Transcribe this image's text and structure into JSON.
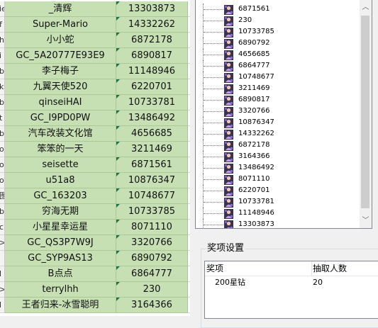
{
  "sheet": {
    "row_header_glyphs": [
      "ie",
      "f",
      "h",
      "i",
      "b",
      "k",
      "b",
      "t",
      "b",
      "o",
      "o",
      "o",
      "图",
      "b",
      "c",
      ">",
      "",
      "l",
      ">",
      "l"
    ],
    "rows": [
      {
        "name": "_清辉",
        "id": "13303873"
      },
      {
        "name": "Super-Mario",
        "id": "14332262"
      },
      {
        "name": "小小蛇",
        "id": "6872178"
      },
      {
        "name": "GC_5A20777E93E9",
        "id": "6890817"
      },
      {
        "name": "李子梅子",
        "id": "11148946"
      },
      {
        "name": "九翼天使520",
        "id": "6220701"
      },
      {
        "name": "qinseiHAI",
        "id": "10733781"
      },
      {
        "name": "GC_I9PD0PW",
        "id": "13486492"
      },
      {
        "name": "汽车改装文化馆",
        "id": "4656685"
      },
      {
        "name": "笨笨的一天",
        "id": "3211469"
      },
      {
        "name": "seisette",
        "id": "6871561"
      },
      {
        "name": "u51a8",
        "id": "10876347"
      },
      {
        "name": "GC_163203",
        "id": "10748677"
      },
      {
        "name": "穷海无期",
        "id": "10733785"
      },
      {
        "name": "小星星幸运星",
        "id": "8071110"
      },
      {
        "name": "GC_QS3P7W9J",
        "id": "3320766"
      },
      {
        "name": "GC_SYP9AS13",
        "id": "6890792"
      },
      {
        "name": "B点点",
        "id": "6864777"
      },
      {
        "name": "terrylhh",
        "id": "230"
      },
      {
        "name": "王者归来-冰雪聪明",
        "id": "3164366"
      }
    ]
  },
  "tree": {
    "items": [
      "6871561",
      "230",
      "10733785",
      "6890792",
      "4656685",
      "6864777",
      "10748677",
      "3211469",
      "6890817",
      "3320766",
      "10876347",
      "14332262",
      "6872178",
      "3164366",
      "13486492",
      "8071110",
      "6220701",
      "10733781",
      "11148946",
      "13303873"
    ],
    "icon_name": "user-avatar-icon"
  },
  "scrollbar": {
    "up": "︿",
    "down": "﹀"
  },
  "prize": {
    "title": "奖项设置",
    "columns": [
      "奖项",
      "抽取人数"
    ],
    "rows": [
      {
        "prize": "200星钻",
        "count": "20"
      }
    ]
  },
  "colors": {
    "cell_green": "#c6e0b4",
    "accent": "#1e7145"
  }
}
